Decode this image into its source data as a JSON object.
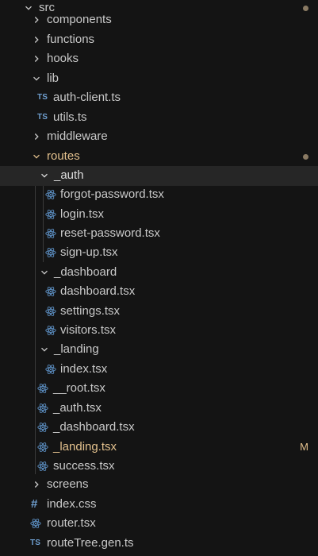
{
  "explorer": {
    "src_label": "src",
    "components_label": "components",
    "functions_label": "functions",
    "hooks_label": "hooks",
    "lib_label": "lib",
    "lib_files": [
      "auth-client.ts",
      "utils.ts"
    ],
    "middleware_label": "middleware",
    "routes_label": "routes",
    "auth_folder_label": "_auth",
    "auth_files": [
      "forgot-password.tsx",
      "login.tsx",
      "reset-password.tsx",
      "sign-up.tsx"
    ],
    "dashboard_folder_label": "_dashboard",
    "dashboard_files": [
      "dashboard.tsx",
      "settings.tsx",
      "visitors.tsx"
    ],
    "landing_folder_label": "_landing",
    "landing_files": [
      "index.tsx"
    ],
    "route_files": [
      "__root.tsx",
      "_auth.tsx",
      "_dashboard.tsx",
      "_landing.tsx",
      "success.tsx"
    ],
    "screens_label": "screens",
    "src_files": [
      "index.css",
      "router.tsx",
      "routeTree.gen.ts"
    ],
    "modified_badge": "M",
    "ts_icon_text": "TS",
    "css_icon_text": "#"
  },
  "colors": {
    "background": "#141414",
    "selected_row": "#262626",
    "text": "#c9c9c9",
    "modified": "#e2c08d",
    "icon_blue": "#6f9fd0",
    "react_icon": "#5b8dc0"
  }
}
